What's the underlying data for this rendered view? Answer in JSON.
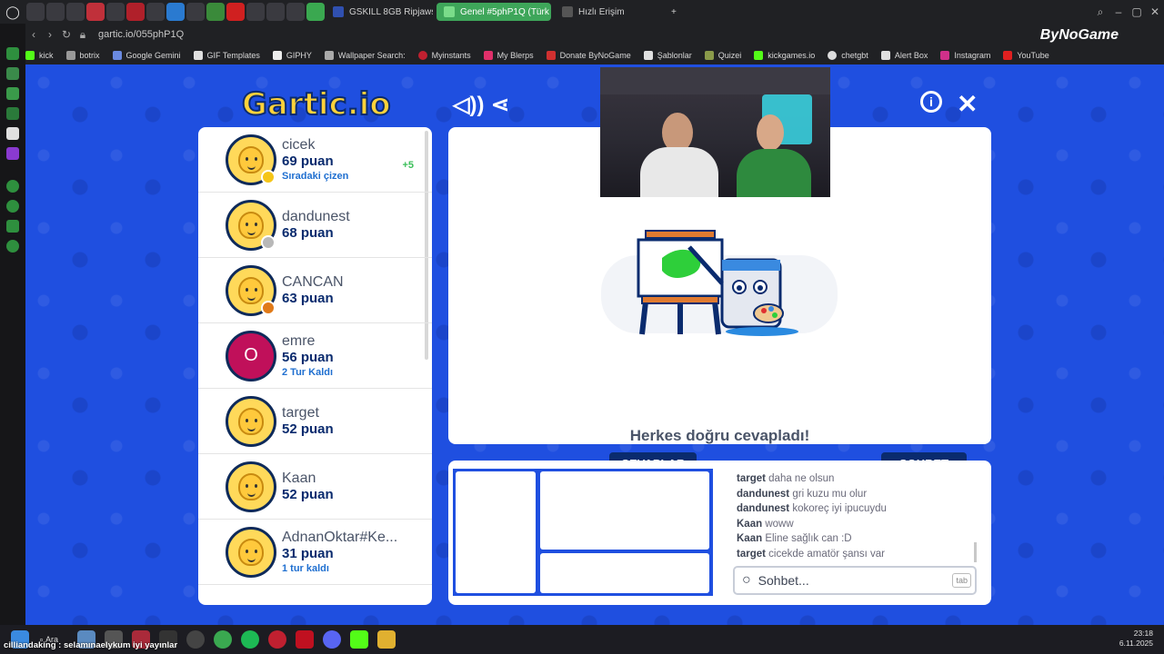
{
  "browser": {
    "tabs": [
      "GSKILL 8GB RipjawsV DD",
      "Genel #5phP1Q (Türk",
      "Hızlı Erişim"
    ],
    "url": "gartic.io/055phP1Q",
    "brand": "ByNoGame"
  },
  "bookmarks": [
    "kick",
    "botrix",
    "Google Gemini",
    "GIF Templates",
    "GIPHY",
    "Wallpaper Search:",
    "Myinstants",
    "My Blerps",
    "Donate ByNoGame",
    "Şablonlar",
    "Quizei",
    "kickgames.io",
    "chetgbt",
    "Alert Box",
    "Instagram",
    "YouTube"
  ],
  "game": {
    "logo_main": "Gartic",
    "logo_ext": ".io",
    "players": [
      {
        "name": "cicek",
        "points": "69 puan",
        "sub": "Sıradaki çizen",
        "bonus": "+5",
        "dot": "#f5c518",
        "avatar": "face"
      },
      {
        "name": "dandunest",
        "points": "68 puan",
        "sub": "",
        "bonus": "",
        "dot": "#b8b8b8",
        "avatar": "face"
      },
      {
        "name": "CANCAN",
        "points": "63 puan",
        "sub": "",
        "bonus": "",
        "dot": "#e07a18",
        "avatar": "face"
      },
      {
        "name": "emre",
        "points": "56 puan",
        "sub": "2 Tur Kaldı",
        "bonus": "",
        "dot": "",
        "avatar": "letter",
        "letter": "O"
      },
      {
        "name": "target",
        "points": "52 puan",
        "sub": "",
        "bonus": "",
        "dot": "",
        "avatar": "face"
      },
      {
        "name": "Kaan",
        "points": "52 puan",
        "sub": "",
        "bonus": "",
        "dot": "",
        "avatar": "face"
      },
      {
        "name": "AdnanOktar#Ke...",
        "points": "31 puan",
        "sub": "1 tur kaldı",
        "bonus": "",
        "dot": "",
        "avatar": "face"
      }
    ],
    "status_message": "Herkes doğru cevapladı!",
    "timer_fraction": 0.905,
    "answers_tab": "CEVAPLAR",
    "chat_tab": "SOHBET",
    "chat": [
      {
        "user": "target",
        "text": "daha ne olsun"
      },
      {
        "user": "dandunest",
        "text": "gri kuzu mu olur"
      },
      {
        "user": "dandunest",
        "text": "kokoreç iyi ipucuydu"
      },
      {
        "user": "Kaan",
        "text": "woww"
      },
      {
        "user": "Kaan",
        "text": "Eline sağlık can :D"
      },
      {
        "user": "target",
        "text": "cicekde amatör şansı var"
      }
    ],
    "chat_placeholder": "Sohbet...",
    "chat_key_hint": "tab"
  },
  "taskbar": {
    "search": "Ara",
    "time": "23:18",
    "date": "6.11.2025",
    "ticker": "cilliandaking : selamınaelykum iyi yayınlar"
  }
}
